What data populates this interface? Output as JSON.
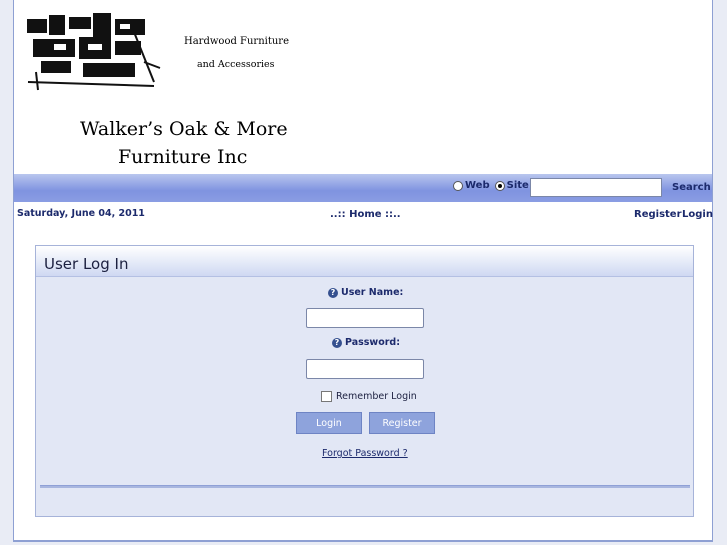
{
  "header": {
    "logo_tagline_1": "Hardwood Furniture",
    "logo_tagline_2": "and Accessories",
    "logo_name_1": "Walker’s Oak & More",
    "logo_name_2": "Furniture Inc"
  },
  "navbar": {
    "radio_web_label": "Web",
    "radio_site_label": "Site",
    "selected_scope": "Site",
    "search_value": "",
    "search_label": "Search"
  },
  "subbar": {
    "date": "Saturday, June 04, 2011",
    "home_link": "..:: Home ::..",
    "register_link": "Register",
    "login_link": "Login"
  },
  "login_panel": {
    "title": "User Log In",
    "username_label": "User Name:",
    "username_value": "",
    "password_label": "Password:",
    "password_value": "",
    "remember_label": "Remember Login",
    "remember_checked": false,
    "login_button": "Login",
    "register_button": "Register",
    "forgot_link": "Forgot Password ?"
  },
  "colors": {
    "accent_blue": "#8ea3dc",
    "link_navy": "#1c2a6c",
    "panel_bg": "#e2e7f5"
  },
  "icons": {
    "help": "help-icon"
  }
}
